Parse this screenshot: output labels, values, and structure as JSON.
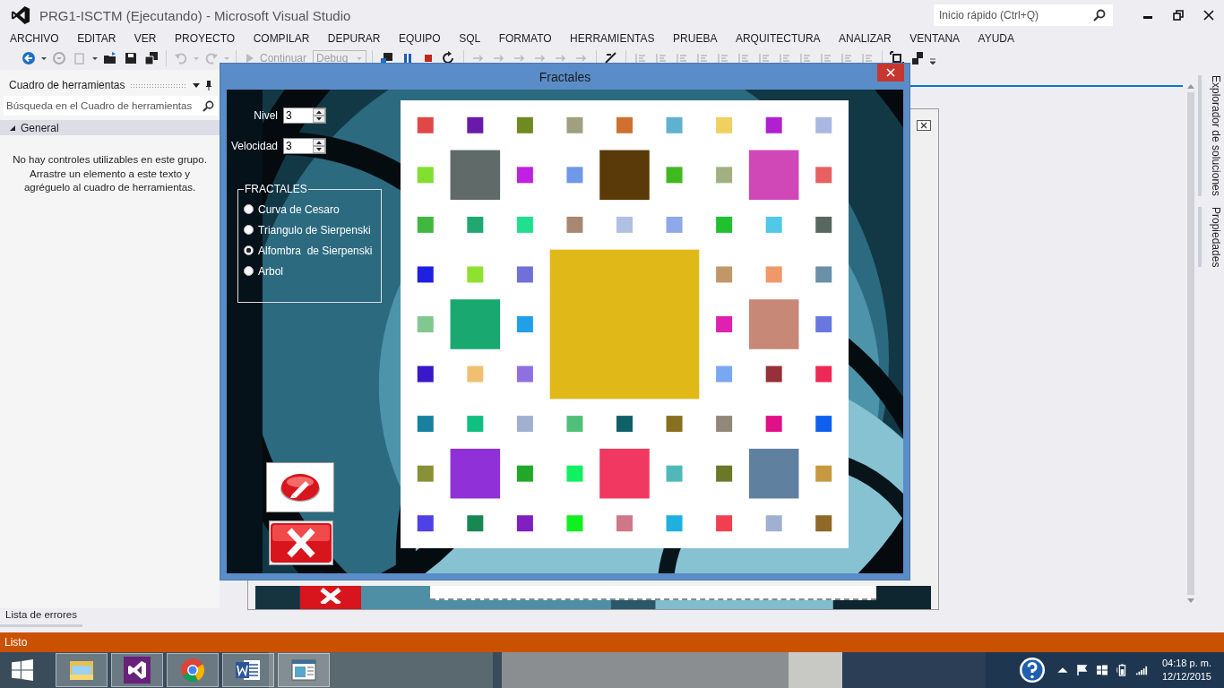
{
  "window": {
    "title": "PRG1-ISCTM (Ejecutando) - Microsoft Visual Studio",
    "quick_launch": {
      "placeholder": "Inicio rápido (Ctrl+Q)"
    }
  },
  "menu": [
    "ARCHIVO",
    "EDITAR",
    "VER",
    "PROYECTO",
    "COMPILAR",
    "DEPURAR",
    "EQUIPO",
    "SQL",
    "FORMATO",
    "HERRAMIENTAS",
    "PRUEBA",
    "ARQUITECTURA",
    "ANALIZAR",
    "VENTANA",
    "AYUDA"
  ],
  "toolbar": {
    "continue": {
      "label": "Continuar",
      "disabled": true
    },
    "configuration": {
      "value": "Debug",
      "disabled": true
    }
  },
  "toolbox": {
    "title": "Cuadro de herramientas",
    "search": {
      "placeholder": "Búsqueda en el Cuadro de herramientas"
    },
    "group": {
      "label": "General",
      "expanded": true
    },
    "message": "No hay controles utilizables en este grupo.\nArrastre un elemento a este texto y\nagréguelo al cuadro de herramientas."
  },
  "side_tabs": [
    "Explorador de soluciones",
    "Propiedades"
  ],
  "bottom_tabs": [
    "Lista de errores"
  ],
  "status_bar": {
    "text": "Listo"
  },
  "dialog": {
    "title": "Fractales",
    "fields": [
      {
        "label": "Nivel",
        "value": "3"
      },
      {
        "label": "Velocidad",
        "value": "3"
      }
    ],
    "group": {
      "title": "FRACTALES",
      "options": [
        {
          "label": "Curva de Cesaro",
          "selected": false
        },
        {
          "label": "Triangulo de Sierpenski",
          "selected": false
        },
        {
          "label": "Alfombra  de Sierpenski",
          "selected": true
        },
        {
          "label": "Arbol",
          "selected": false
        }
      ]
    },
    "carpet": {
      "large": {
        "color": "#e0b818"
      },
      "medium": [
        {
          "color": "#606a68"
        },
        {
          "color": "#5a3a08"
        },
        {
          "color": "#d048b8"
        },
        {
          "color": "#18a870"
        },
        {
          "color": "#c88878"
        },
        {
          "color": "#9030d8"
        },
        {
          "color": "#f03860"
        },
        {
          "color": "#6080a0"
        }
      ],
      "small": [
        {
          "color": "#e04848"
        },
        {
          "color": "#6a1aa8"
        },
        {
          "color": "#6e8a20"
        },
        {
          "color": "#a0a080"
        },
        {
          "color": "#d07030"
        },
        {
          "color": "#60b0d0"
        },
        {
          "color": "#f0d060"
        },
        {
          "color": "#b020d0"
        },
        {
          "color": "#a8b8e0"
        },
        {
          "color": "#80e030"
        },
        {
          "color": "#c020e0"
        },
        {
          "color": "#7098e8"
        },
        {
          "color": "#40b820"
        },
        {
          "color": "#a0b080"
        },
        {
          "color": "#e86060"
        },
        {
          "color": "#40b840"
        },
        {
          "color": "#20a870"
        },
        {
          "color": "#20e090"
        },
        {
          "color": "#a88870"
        },
        {
          "color": "#b0c0e0"
        },
        {
          "color": "#90a8e8"
        },
        {
          "color": "#20c030"
        },
        {
          "color": "#50c8e8"
        },
        {
          "color": "#586860"
        },
        {
          "color": "#2020e0"
        },
        {
          "color": "#90e030"
        },
        {
          "color": "#7070d8"
        },
        {
          "color": "#c09868"
        },
        {
          "color": "#f09868"
        },
        {
          "color": "#6890a8"
        },
        {
          "color": "#80c890"
        },
        {
          "color": "#20a0e8"
        },
        {
          "color": "#e020b0"
        },
        {
          "color": "#6878e0"
        },
        {
          "color": "#3818c8"
        },
        {
          "color": "#f0c070"
        },
        {
          "color": "#9070e0"
        },
        {
          "color": "#78a8f0"
        },
        {
          "color": "#983038"
        },
        {
          "color": "#f02858"
        },
        {
          "color": "#1880a0"
        },
        {
          "color": "#10c080"
        },
        {
          "color": "#a0b0d0"
        },
        {
          "color": "#50c078"
        },
        {
          "color": "#106068"
        },
        {
          "color": "#887020"
        },
        {
          "color": "#908878"
        },
        {
          "color": "#e01088"
        },
        {
          "color": "#1060f0"
        },
        {
          "color": "#889038"
        },
        {
          "color": "#20a828"
        },
        {
          "color": "#10f060"
        },
        {
          "color": "#50b8b8"
        },
        {
          "color": "#6a7828"
        },
        {
          "color": "#c89840"
        },
        {
          "color": "#5040e8"
        },
        {
          "color": "#188850"
        },
        {
          "color": "#8020c0"
        },
        {
          "color": "#10f020"
        },
        {
          "color": "#d07888"
        },
        {
          "color": "#20b0e0"
        },
        {
          "color": "#f04050"
        },
        {
          "color": "#a0b0d0"
        },
        {
          "color": "#906828"
        }
      ]
    }
  },
  "taskbar": {
    "apps": [
      {
        "kind": "explorer"
      },
      {
        "kind": "visual-studio"
      },
      {
        "kind": "chrome"
      },
      {
        "kind": "word"
      },
      {
        "kind": "form"
      }
    ],
    "time": "04:18 p. m.",
    "date": "12/12/2015"
  }
}
